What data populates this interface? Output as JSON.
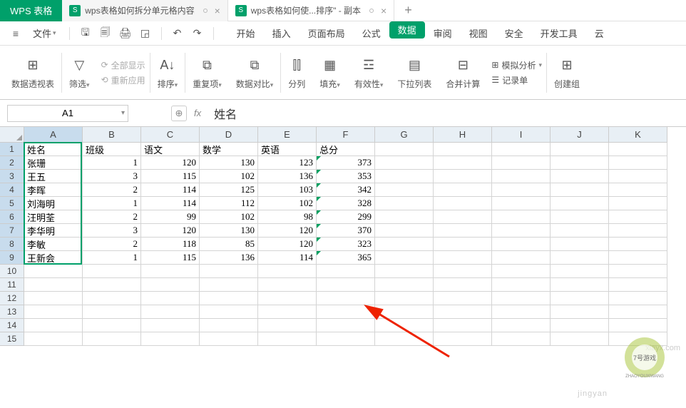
{
  "app_name": "WPS 表格",
  "tabs": [
    {
      "icon": "S",
      "label": "wps表格如何拆分单元格内容",
      "active": true
    },
    {
      "icon": "S",
      "label": "wps表格如何使...排序\" - 副本",
      "active": false
    }
  ],
  "file_menu": "文件",
  "menu_tabs": [
    "开始",
    "插入",
    "页面布局",
    "公式",
    "数据",
    "审阅",
    "视图",
    "安全",
    "开发工具",
    "云"
  ],
  "menu_active_index": 4,
  "ribbon": {
    "pivot": "数据透视表",
    "filter": "筛选",
    "show_all": "全部显示",
    "reapply": "重新应用",
    "sort": "排序",
    "dup": "重复项",
    "compare": "数据对比",
    "split": "分列",
    "fill": "填充",
    "validity": "有效性",
    "dropdown": "下拉列表",
    "consolidate": "合并计算",
    "simulate": "模拟分析",
    "record": "记录单",
    "group": "创建组"
  },
  "name_box": "A1",
  "formula": "姓名",
  "columns": [
    "A",
    "B",
    "C",
    "D",
    "E",
    "F",
    "G",
    "H",
    "I",
    "J",
    "K"
  ],
  "rows": [
    1,
    2,
    3,
    4,
    5,
    6,
    7,
    8,
    9,
    10,
    11,
    12,
    13,
    14,
    15
  ],
  "headers": [
    "姓名",
    "班级",
    "语文",
    "数学",
    "英语",
    "总分"
  ],
  "data_rows": [
    [
      "张珊",
      "1",
      "120",
      "130",
      "123",
      "373"
    ],
    [
      "王五",
      "3",
      "115",
      "102",
      "136",
      "353"
    ],
    [
      "李晖",
      "2",
      "114",
      "125",
      "103",
      "342"
    ],
    [
      "刘海明",
      "1",
      "114",
      "112",
      "102",
      "328"
    ],
    [
      "汪明荃",
      "2",
      "99",
      "102",
      "98",
      "299"
    ],
    [
      "李华明",
      "3",
      "120",
      "130",
      "120",
      "370"
    ],
    [
      "李敏",
      "2",
      "118",
      "85",
      "120",
      "323"
    ],
    [
      "王新会",
      "1",
      "115",
      "136",
      "114",
      "365"
    ]
  ],
  "watermark_small": "7号游戏",
  "watermark_url": "xiayx.com",
  "watermark_pinyin": "ZHAOYOUXIWANG",
  "watermark_bottom": "jingyan"
}
